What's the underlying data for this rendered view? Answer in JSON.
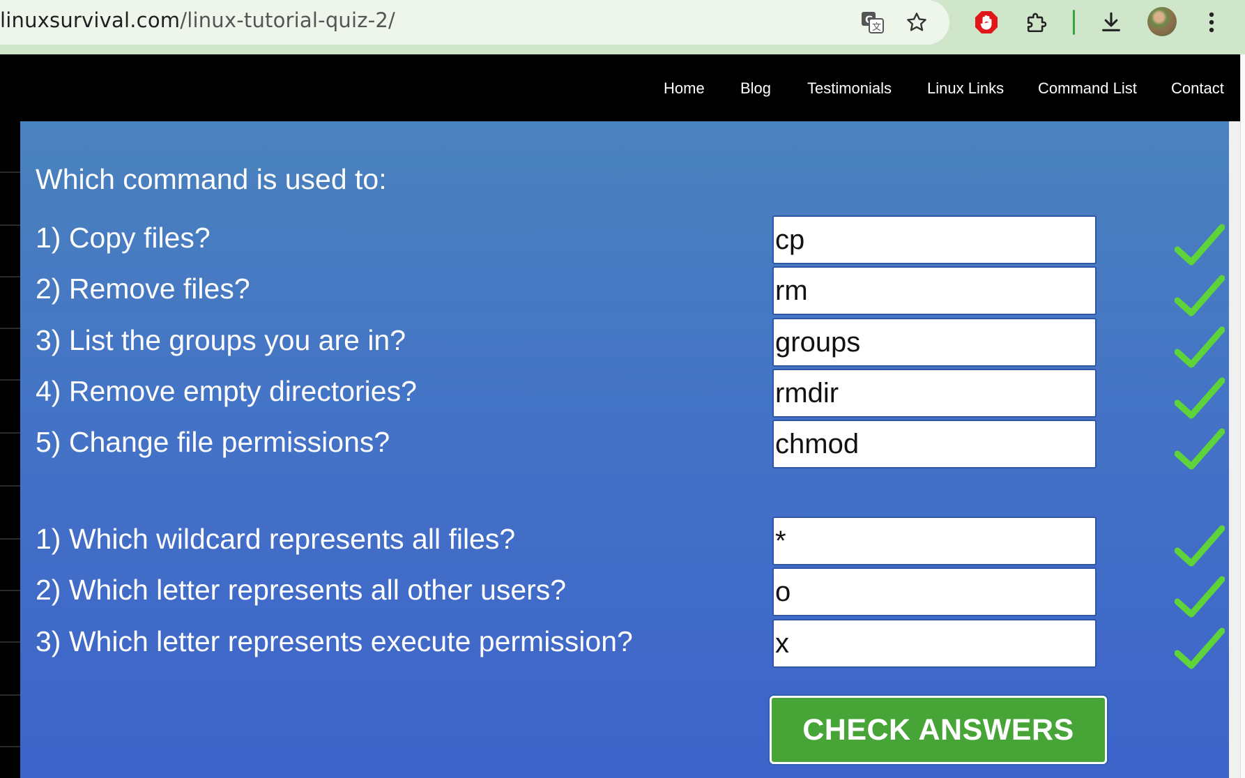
{
  "browser": {
    "url_domain": "linuxsurvival.com",
    "url_path": "/linux-tutorial-quiz-2/",
    "icons": [
      "translate-icon",
      "bookmark-star-icon",
      "adblock-stop-icon",
      "extensions-icon",
      "download-icon",
      "profile-avatar",
      "more-menu-icon"
    ]
  },
  "nav": {
    "items": [
      "Home",
      "Blog",
      "Testimonials",
      "Linux Links",
      "Command List",
      "Contact"
    ]
  },
  "quiz": {
    "heading": "Which command is used to:",
    "section1": [
      {
        "question": "1) Copy files?",
        "answer": "cp"
      },
      {
        "question": "2) Remove files?",
        "answer": "rm"
      },
      {
        "question": "3) List the groups you are in?",
        "answer": "groups"
      },
      {
        "question": "4) Remove empty directories?",
        "answer": "rmdir"
      },
      {
        "question": "5) Change file permissions?",
        "answer": "chmod"
      }
    ],
    "section2": [
      {
        "question": "1) Which wildcard represents all files?",
        "answer": "*"
      },
      {
        "question": "2) Which letter represents all other users?",
        "answer": "o"
      },
      {
        "question": "3) Which letter represents execute permission?",
        "answer": "x"
      }
    ],
    "check_button": "CHECK ANSWERS"
  },
  "colors": {
    "panel_top": "#4a82bd",
    "panel_bottom": "#3d63c9",
    "button_green": "#47a537",
    "checkmark_green": "#5fd33a"
  }
}
